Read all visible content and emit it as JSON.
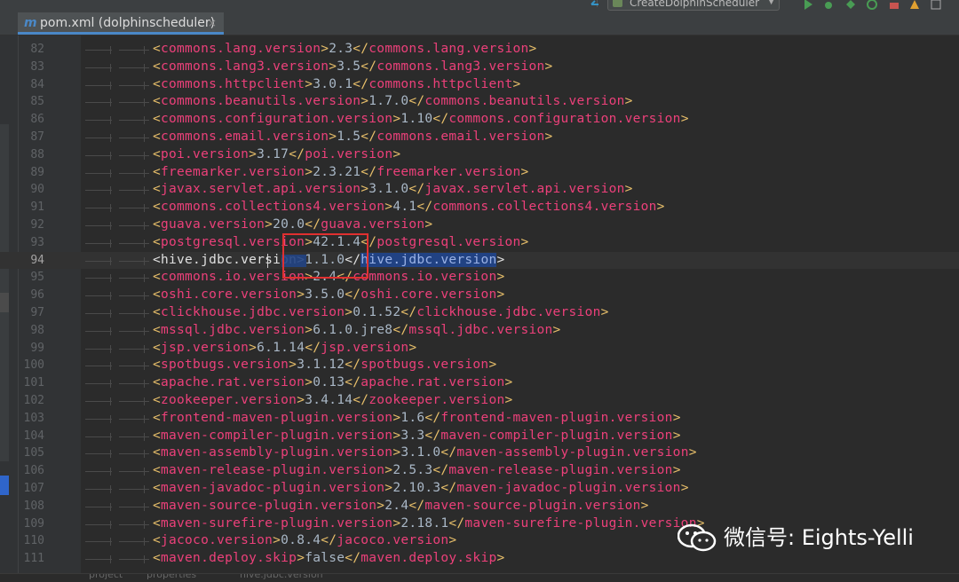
{
  "toolbar": {
    "run_config": "CreateDolphinScheduler"
  },
  "tab": {
    "label": "pom.xml (dolphinscheduler)",
    "close": "×",
    "file_icon": "m"
  },
  "editor": {
    "current_line": 94,
    "lines": [
      {
        "n": "82",
        "tag": "commons.lang.version",
        "value": "2.3"
      },
      {
        "n": "83",
        "tag": "commons.lang3.version",
        "value": "3.5"
      },
      {
        "n": "84",
        "tag": "commons.httpclient",
        "value": "3.0.1"
      },
      {
        "n": "85",
        "tag": "commons.beanutils.version",
        "value": "1.7.0"
      },
      {
        "n": "86",
        "tag": "commons.configuration.version",
        "value": "1.10"
      },
      {
        "n": "87",
        "tag": "commons.email.version",
        "value": "1.5"
      },
      {
        "n": "88",
        "tag": "poi.version",
        "value": "3.17"
      },
      {
        "n": "89",
        "tag": "freemarker.version",
        "value": "2.3.21"
      },
      {
        "n": "90",
        "tag": "javax.servlet.api.version",
        "value": "3.1.0"
      },
      {
        "n": "91",
        "tag": "commons.collections4.version",
        "value": "4.1"
      },
      {
        "n": "92",
        "tag": "guava.version",
        "value": "20.0"
      },
      {
        "n": "93",
        "tag": "postgresql.version",
        "value": "42.1.4"
      },
      {
        "n": "94",
        "tag": "hive.jdbc.version",
        "value": "1.1.0"
      },
      {
        "n": "95",
        "tag": "commons.io.version",
        "value": "2.4"
      },
      {
        "n": "96",
        "tag": "oshi.core.version",
        "value": "3.5.0"
      },
      {
        "n": "97",
        "tag": "clickhouse.jdbc.version",
        "value": "0.1.52"
      },
      {
        "n": "98",
        "tag": "mssql.jdbc.version",
        "value": "6.1.0.jre8"
      },
      {
        "n": "99",
        "tag": "jsp.version",
        "value": "6.1.14"
      },
      {
        "n": "100",
        "tag": "spotbugs.version",
        "value": "3.1.12"
      },
      {
        "n": "101",
        "tag": "apache.rat.version",
        "value": "0.13"
      },
      {
        "n": "102",
        "tag": "zookeeper.version",
        "value": "3.4.14"
      },
      {
        "n": "103",
        "tag": "frontend-maven-plugin.version",
        "value": "1.6"
      },
      {
        "n": "104",
        "tag": "maven-compiler-plugin.version",
        "value": "3.3"
      },
      {
        "n": "105",
        "tag": "maven-assembly-plugin.version",
        "value": "3.1.0"
      },
      {
        "n": "106",
        "tag": "maven-release-plugin.version",
        "value": "2.5.3"
      },
      {
        "n": "107",
        "tag": "maven-javadoc-plugin.version",
        "value": "2.10.3"
      },
      {
        "n": "108",
        "tag": "maven-source-plugin.version",
        "value": "2.4"
      },
      {
        "n": "109",
        "tag": "maven-surefire-plugin.version",
        "value": "2.18.1"
      },
      {
        "n": "110",
        "tag": "jacoco.version",
        "value": "0.8.4"
      },
      {
        "n": "111",
        "tag": "maven.deploy.skip",
        "value": "false"
      }
    ]
  },
  "breadcrumb": [
    "project",
    "properties",
    "hive.jdbc.version"
  ],
  "watermark": {
    "text": "微信号: Eights-Yelli",
    "icon": "wechat-icon"
  },
  "colors": {
    "tag": "#ec407a",
    "bracket": "#e8bf6a",
    "value": "#a9b7c6",
    "selection": "#214283",
    "annotation": "#e03030"
  }
}
